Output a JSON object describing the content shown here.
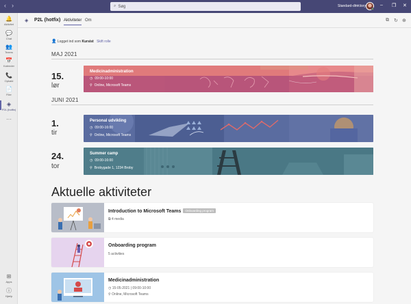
{
  "titlebar": {
    "search_placeholder": "Søg",
    "directory": "Standard-directory",
    "back_glyph": "‹",
    "forward_glyph": "›",
    "minimize_glyph": "–",
    "maximize_glyph": "❐",
    "close_glyph": "✕",
    "more_glyph": "···"
  },
  "rail": {
    "items": [
      {
        "label": "Aktivitet",
        "icon": "bell-icon",
        "glyph": "🔔"
      },
      {
        "label": "Chat",
        "icon": "chat-icon",
        "glyph": "💬"
      },
      {
        "label": "Teams",
        "icon": "teams-icon",
        "glyph": "👥"
      },
      {
        "label": "Kalender",
        "icon": "calendar-icon",
        "glyph": "📅"
      },
      {
        "label": "Opkald",
        "icon": "phone-icon",
        "glyph": "📞"
      },
      {
        "label": "Filer",
        "icon": "file-icon",
        "glyph": "📄"
      },
      {
        "label": "P2L (hotfix)",
        "icon": "stack-icon",
        "glyph": "◈"
      }
    ],
    "more_glyph": "···",
    "apps_label": "Apps",
    "help_label": "Hjælp"
  },
  "header": {
    "app_name": "P2L (hotfix)",
    "tabs": [
      {
        "label": "Aktiviteter"
      },
      {
        "label": "Om"
      }
    ]
  },
  "login": {
    "prefix": "Logget ind som",
    "role": "Kursist",
    "switch": "Skift rolle"
  },
  "months": [
    {
      "label": "MAJ 2021",
      "events": [
        {
          "day": "15.",
          "weekday": "lør",
          "title": "Medicinadministration",
          "time": "09:00-10:00",
          "place": "Online, Microsoft Teams"
        }
      ]
    },
    {
      "label": "JUNI 2021",
      "events": [
        {
          "day": "1.",
          "weekday": "tir",
          "title": "Personal udvikling",
          "time": "09:00-16:00",
          "place": "Online, Microsoft Teams"
        },
        {
          "day": "24.",
          "weekday": "tor",
          "title": "Summer camp",
          "time": "09:00-16:00",
          "place": "Brobygade 1, 1234 Broby"
        }
      ]
    }
  ],
  "current": {
    "heading": "Aktuelle aktiviteter",
    "items": [
      {
        "title": "Introduction to Microsoft Teams",
        "badge": "Onboarding program",
        "line1": "4 media",
        "line2": ""
      },
      {
        "title": "Onboarding program",
        "badge": "",
        "line1": "5 activities",
        "line2": ""
      },
      {
        "title": "Medicinadministration",
        "badge": "",
        "line1": "15-05-2021 | 09:00-10:00",
        "line2": "Online, Microsoft Teams"
      }
    ]
  },
  "colors": {
    "titlebar": "#464775",
    "accent": "#6264a7",
    "card_may": "#d16a7c",
    "card_june1": "#5a6ca0",
    "card_june2": "#4f7d8a"
  }
}
